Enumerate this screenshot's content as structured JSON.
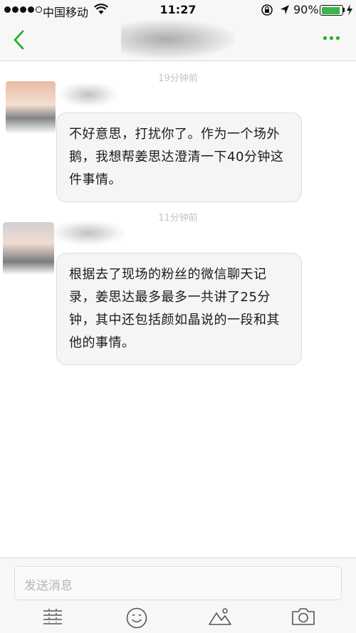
{
  "status_bar": {
    "carrier": "中国移动",
    "time": "11:27",
    "battery_percent": "90%",
    "battery_level": 0.9
  },
  "nav": {
    "back_icon": "chevron-left-icon",
    "more_icon": "more-dots-icon",
    "accent_color": "#1aad19"
  },
  "messages": [
    {
      "timestamp": "19分钟前",
      "text": "不好意思，打扰你了。作为一个场外鹅，我想帮姜思达澄清一下40分钟这件事情。"
    },
    {
      "timestamp": "11分钟前",
      "text": "根据去了现场的粉丝的微信聊天记录，姜思达最多最多一共讲了25分钟，其中还包括颜如晶说的一段和其他的事情。"
    }
  ],
  "composer": {
    "placeholder": "发送消息",
    "tools": [
      "list-icon",
      "emoji-icon",
      "image-icon",
      "camera-icon"
    ]
  }
}
